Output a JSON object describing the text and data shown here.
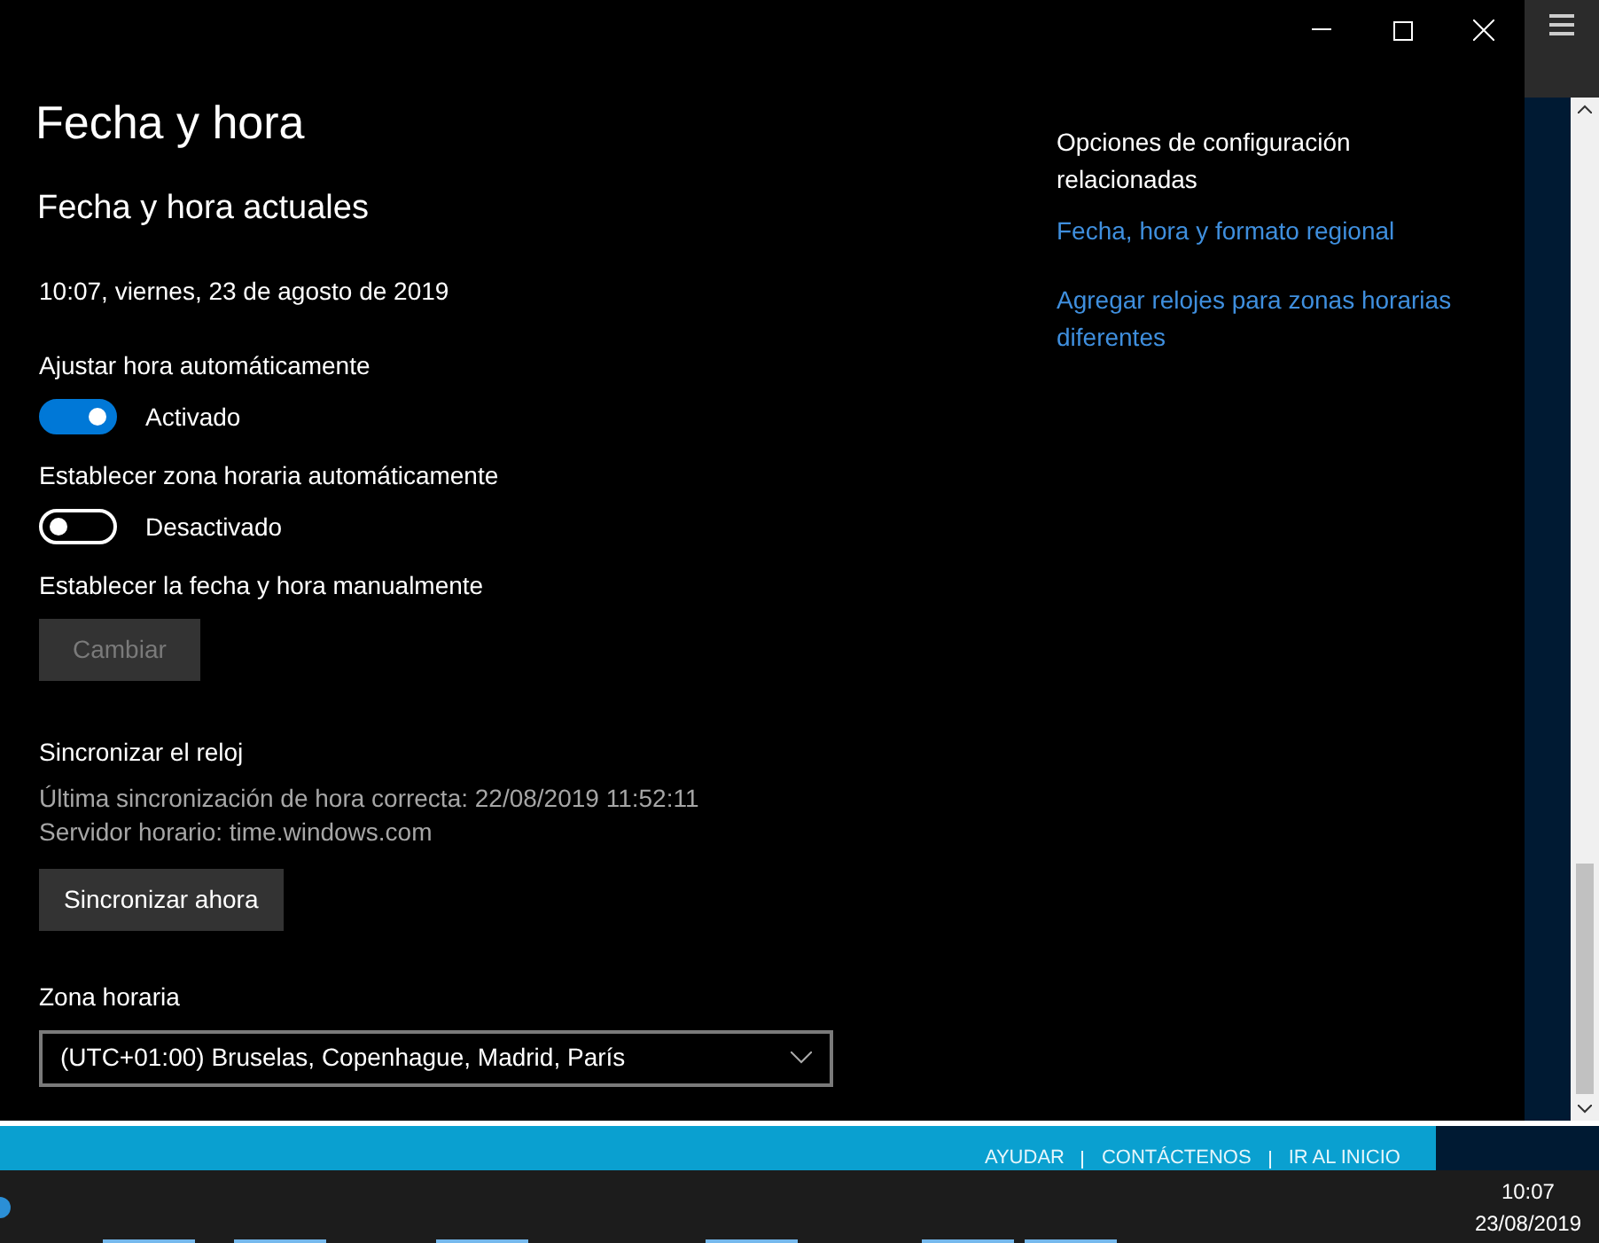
{
  "window": {
    "title": "Fecha y hora"
  },
  "section_title": "Fecha y hora actuales",
  "current_datetime": "10:07, viernes, 23 de agosto de 2019",
  "settings": [
    {
      "kind": "toggle",
      "label": "Ajustar hora automáticamente",
      "on": true,
      "state_text": "Activado"
    },
    {
      "kind": "toggle",
      "label": "Establecer zona horaria automáticamente",
      "on": false,
      "state_text": "Desactivado"
    },
    {
      "kind": "button",
      "label": "Establecer la fecha y hora manualmente",
      "button": "Cambiar",
      "disabled": true
    }
  ],
  "sync": {
    "title": "Sincronizar el reloj",
    "last_sync": "Última sincronización de hora correcta: 22/08/2019 11:52:11",
    "server": "Servidor horario: time.windows.com",
    "button": "Sincronizar ahora"
  },
  "timezone": {
    "label": "Zona horaria",
    "value": "(UTC+01:00) Bruselas, Copenhague, Madrid, París"
  },
  "related": {
    "title": "Opciones de configuración relacionadas",
    "links": [
      "Fecha, hora y formato regional",
      "Agregar relojes para zonas horarias diferentes"
    ]
  },
  "background_page": {
    "footer_links": [
      "AYUDAR",
      "CONTÁCTENOS",
      "IR AL INICIO"
    ]
  },
  "taskbar": {
    "time": "10:07",
    "date": "23/08/2019"
  }
}
